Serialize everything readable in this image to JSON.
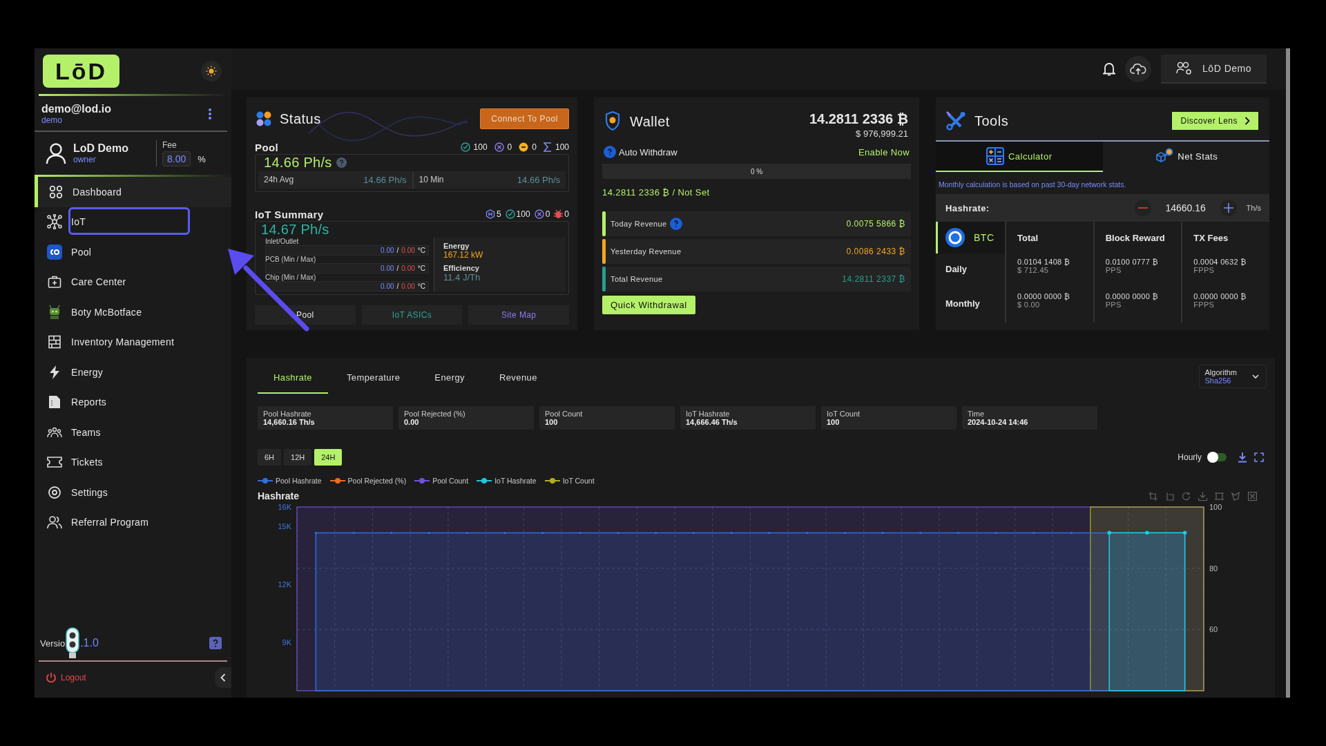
{
  "header": {
    "user_button": "LōD Demo"
  },
  "sidebar": {
    "logo": "LōD",
    "email": "demo@lod.io",
    "username": "demo",
    "profile": {
      "name": "LoD Demo",
      "role": "owner",
      "fee_label": "Fee",
      "fee_value": "8.00",
      "fee_unit": "%"
    },
    "nav": [
      {
        "label": "Dashboard",
        "kind": "dashboard",
        "selected": true,
        "highlighted": false
      },
      {
        "label": "IoT",
        "kind": "iot",
        "selected": false,
        "highlighted": true
      },
      {
        "label": "Pool",
        "kind": "pool",
        "selected": false,
        "highlighted": false
      },
      {
        "label": "Care Center",
        "kind": "care",
        "selected": false,
        "highlighted": false
      },
      {
        "label": "Boty McBotface",
        "kind": "bot",
        "selected": false,
        "highlighted": false
      },
      {
        "label": "Inventory Management",
        "kind": "inventory",
        "selected": false,
        "highlighted": false
      },
      {
        "label": "Energy",
        "kind": "energy",
        "selected": false,
        "highlighted": false
      },
      {
        "label": "Reports",
        "kind": "reports",
        "selected": false,
        "highlighted": false
      },
      {
        "label": "Teams",
        "kind": "teams",
        "selected": false,
        "highlighted": false
      },
      {
        "label": "Tickets",
        "kind": "tickets",
        "selected": false,
        "highlighted": false
      },
      {
        "label": "Settings",
        "kind": "settings",
        "selected": false,
        "highlighted": false
      },
      {
        "label": "Referral Program",
        "kind": "referral",
        "selected": false,
        "highlighted": false
      }
    ],
    "version_label": "Versio",
    "version_value": ".1.0",
    "logout": "Logout"
  },
  "status": {
    "title": "Status",
    "connect_button": "Connect To Pool",
    "pool": {
      "title": "Pool",
      "hashrate": "14.66 Ph/s",
      "counts": [
        {
          "kind": "ok",
          "value": "100"
        },
        {
          "kind": "error",
          "value": "0"
        },
        {
          "kind": "warning",
          "value": "0"
        },
        {
          "kind": "total",
          "value": "100"
        }
      ],
      "avg_label": "24h Avg",
      "avg_value": "14.66 Ph/s",
      "recent_label": "10 Min",
      "recent_value": "14.66 Ph/s"
    },
    "iot": {
      "title": "IoT Summary",
      "hashrate": "14.67 Ph/s",
      "counts": [
        {
          "kind": "hash",
          "value": "5"
        },
        {
          "kind": "ok",
          "value": "100"
        },
        {
          "kind": "error",
          "value": "0"
        },
        {
          "kind": "bug",
          "value": "0"
        }
      ],
      "temps": [
        {
          "label": "Inlet/Outlet",
          "min": "0.00",
          "sep": "/",
          "max": "0.00",
          "unit": "°C"
        },
        {
          "label": "PCB (Min / Max)",
          "min": "0.00",
          "sep": "/",
          "max": "0.00",
          "unit": "°C"
        },
        {
          "label": "Chip (Min / Max)",
          "min": "0.00",
          "sep": "/",
          "max": "0.00",
          "unit": "°C"
        }
      ],
      "energy_label": "Energy",
      "energy_value": "167.12 kW",
      "efficiency_label": "Efficiency",
      "efficiency_value": "11.4 J/Th"
    },
    "links": [
      {
        "label": "Pool",
        "color": "#e6e6e6"
      },
      {
        "label": "IoT ASICs",
        "color": "#2aa59a"
      },
      {
        "label": "Site Map",
        "color": "#8b7cf6"
      }
    ]
  },
  "wallet": {
    "title": "Wallet",
    "balance": "14.2811 2336 ₿",
    "balance_usd": "$ 976,999.21",
    "auto_withdraw_label": "Auto Withdraw",
    "enable_link": "Enable Now",
    "progress": {
      "level": 0,
      "text": "0 %"
    },
    "threshold": "14.2811 2336 ₿ / Not Set",
    "revenues": [
      {
        "label": "Today Revenue",
        "value": "0.0075 5866 ₿",
        "color": "#b5f06a",
        "help": true
      },
      {
        "label": "Yesterday Revenue",
        "value": "0.0086 2433 ₿",
        "color": "#f5a623",
        "help": false
      },
      {
        "label": "Total Revenue",
        "value": "14.2811 2337 ₿",
        "color": "#2a9d8f",
        "help": false
      }
    ],
    "quick_button": "Quick Withdrawal"
  },
  "tools": {
    "title": "Tools",
    "discover_button": "Discover Lens",
    "tabs": [
      {
        "label": "Calculator",
        "kind": "calculator",
        "selected": true
      },
      {
        "label": "Net Stats",
        "kind": "netstats",
        "selected": false
      }
    ],
    "note": "Monthly calculation is based on past 30-day network stats.",
    "hashrate_label": "Hashrate:",
    "hashrate_value": "14660.16",
    "hashrate_unit": "Th/s",
    "coin": "BTC",
    "columns": [
      "Total",
      "Block Reward",
      "TX Fees"
    ],
    "rows": [
      {
        "label": "Daily",
        "cells": [
          {
            "amount": "0.0104 1408 ₿",
            "sub": "$ 712.45"
          },
          {
            "amount": "0.0100 0777 ₿",
            "sub": "PPS"
          },
          {
            "amount": "0.0004 0632 ₿",
            "sub": "FPPS"
          }
        ]
      },
      {
        "label": "Monthly",
        "cells": [
          {
            "amount": "0.0000 0000 ₿",
            "sub": "$ 0.00"
          },
          {
            "amount": "0.0000 0000 ₿",
            "sub": "PPS"
          },
          {
            "amount": "0.0000 0000 ₿",
            "sub": "FPPS"
          }
        ]
      }
    ]
  },
  "panel": {
    "tabs": [
      {
        "label": "Hashrate",
        "selected": true
      },
      {
        "label": "Temperature",
        "selected": false
      },
      {
        "label": "Energy",
        "selected": false
      },
      {
        "label": "Revenue",
        "selected": false
      }
    ],
    "algorithm": {
      "label": "Algorithm",
      "value": "Sha256"
    },
    "stats": [
      {
        "label": "Pool Hashrate",
        "value": "14,660.16 Th/s"
      },
      {
        "label": "Pool Rejected (%)",
        "value": "0.00"
      },
      {
        "label": "Pool Count",
        "value": "100"
      },
      {
        "label": "IoT Hashrate",
        "value": "14,666.46 Th/s"
      },
      {
        "label": "IoT Count",
        "value": "100"
      },
      {
        "label": "Time",
        "value": "2024-10-24 14:46"
      }
    ],
    "ranges": [
      {
        "label": "6H",
        "selected": false
      },
      {
        "label": "12H",
        "selected": false
      },
      {
        "label": "24H",
        "selected": true
      }
    ],
    "hourly": {
      "label": "Hourly",
      "on": false
    },
    "chart": {
      "legend": [
        {
          "kind": "series"
        },
        {
          "kind": "extra",
          "name": "Pool Rejected (%)",
          "color": "#f06a20"
        },
        {
          "kind": "extra",
          "name": "Pool Count",
          "color": "#7050e0"
        },
        {
          "kind": "series"
        },
        {
          "kind": "extra",
          "name": "IoT Count",
          "color": "#b0b020"
        }
      ],
      "right_ticks": [
        "100",
        "80",
        "60"
      ],
      "chart_data": {
        "type": "area",
        "title": "Hashrate",
        "ylim": [
          6500,
          16000
        ],
        "yticks": [
          {
            "value": 9000,
            "label": "9K"
          },
          {
            "value": 12000,
            "label": "12K"
          },
          {
            "value": 15000,
            "label": "15K"
          },
          {
            "value": 16000,
            "label": "16K"
          }
        ],
        "grid": true,
        "series": [
          {
            "name": "Pool Hashrate",
            "color": "#2f6fe0",
            "values": [
              14660,
              14660,
              14660,
              14660,
              14660,
              14660,
              14660,
              14660,
              14660,
              14660,
              14660,
              14660,
              14660,
              14660,
              14660,
              14660,
              14660,
              14660,
              14660,
              14660,
              14660,
              14660,
              14660,
              14660
            ]
          },
          {
            "name": "IoT Hashrate",
            "color": "#20c8e0",
            "values": [
              null,
              null,
              null,
              null,
              null,
              null,
              null,
              null,
              null,
              null,
              null,
              null,
              null,
              null,
              null,
              null,
              null,
              null,
              null,
              null,
              null,
              14670,
              14670,
              14670
            ]
          }
        ]
      }
    }
  }
}
